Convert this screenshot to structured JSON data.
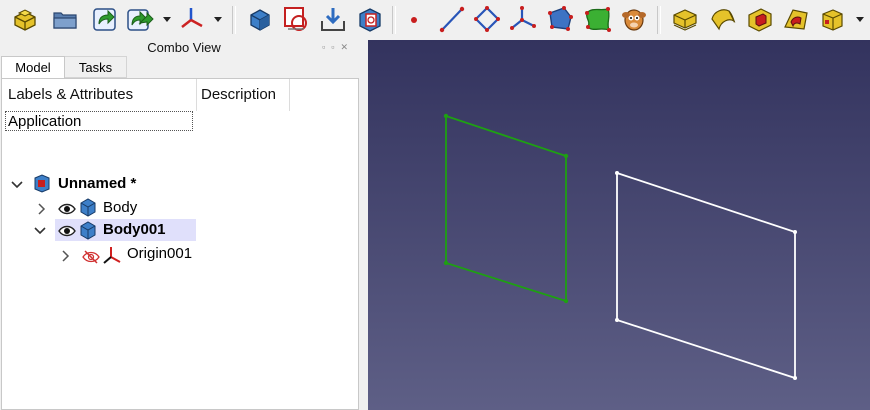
{
  "toolbar": {
    "icons": [
      "new-part-icon",
      "open-folder-icon",
      "export-icon",
      "export-multi-icon",
      "axis-icon",
      "sketch-body-icon",
      "create-sketch-icon",
      "import-icon",
      "map-sketch-icon",
      "point-icon",
      "line-icon",
      "polygon-icon",
      "axis-lines-icon",
      "face-icon",
      "surface-icon",
      "sheep-icon",
      "pad-icon",
      "revolve-icon",
      "pocket-icon",
      "groove-icon",
      "box-icon"
    ]
  },
  "panel": {
    "title": "Combo View",
    "tabs": {
      "model": "Model",
      "tasks": "Tasks"
    },
    "columns": {
      "labels": "Labels & Attributes",
      "description": "Description"
    },
    "root": "Application",
    "tree": {
      "document": "Unnamed *",
      "body": "Body",
      "body001": "Body001",
      "origin": "Origin001"
    }
  },
  "viewport": {
    "colors": {
      "active_sketch": "#1ea012",
      "inactive_sketch": "#ffffff",
      "bg_top": "#33335e",
      "bg_bottom": "#5e5f86"
    }
  }
}
